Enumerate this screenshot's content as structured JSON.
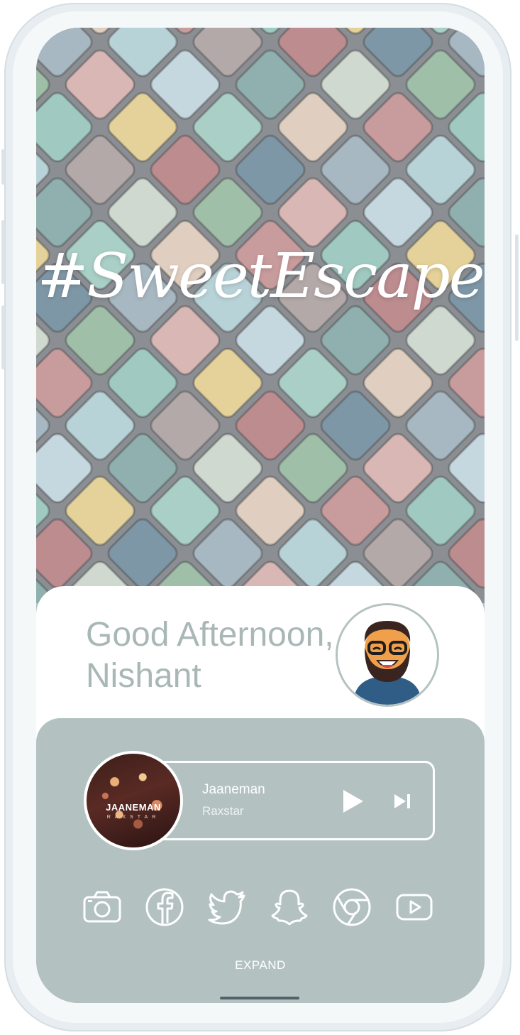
{
  "hero": {
    "brand_text": "#SweetEscape"
  },
  "greeting": {
    "line1": "Good Afternoon,",
    "line2": "Nishant"
  },
  "player": {
    "album_art_title": "JAANEMAN",
    "album_art_subtitle": "RAXSTAR",
    "song_title": "Jaaneman",
    "artist": "Raxstar"
  },
  "apps": [
    {
      "icon": "camera-icon"
    },
    {
      "icon": "facebook-icon"
    },
    {
      "icon": "twitter-icon"
    },
    {
      "icon": "snapchat-icon"
    },
    {
      "icon": "chrome-icon"
    },
    {
      "icon": "youtube-icon"
    }
  ],
  "expand_label": "EXPAND",
  "colors": {
    "panel": "#b3c1c1",
    "greeting_text": "#a9b7b7",
    "frame": "#e7edf0"
  }
}
